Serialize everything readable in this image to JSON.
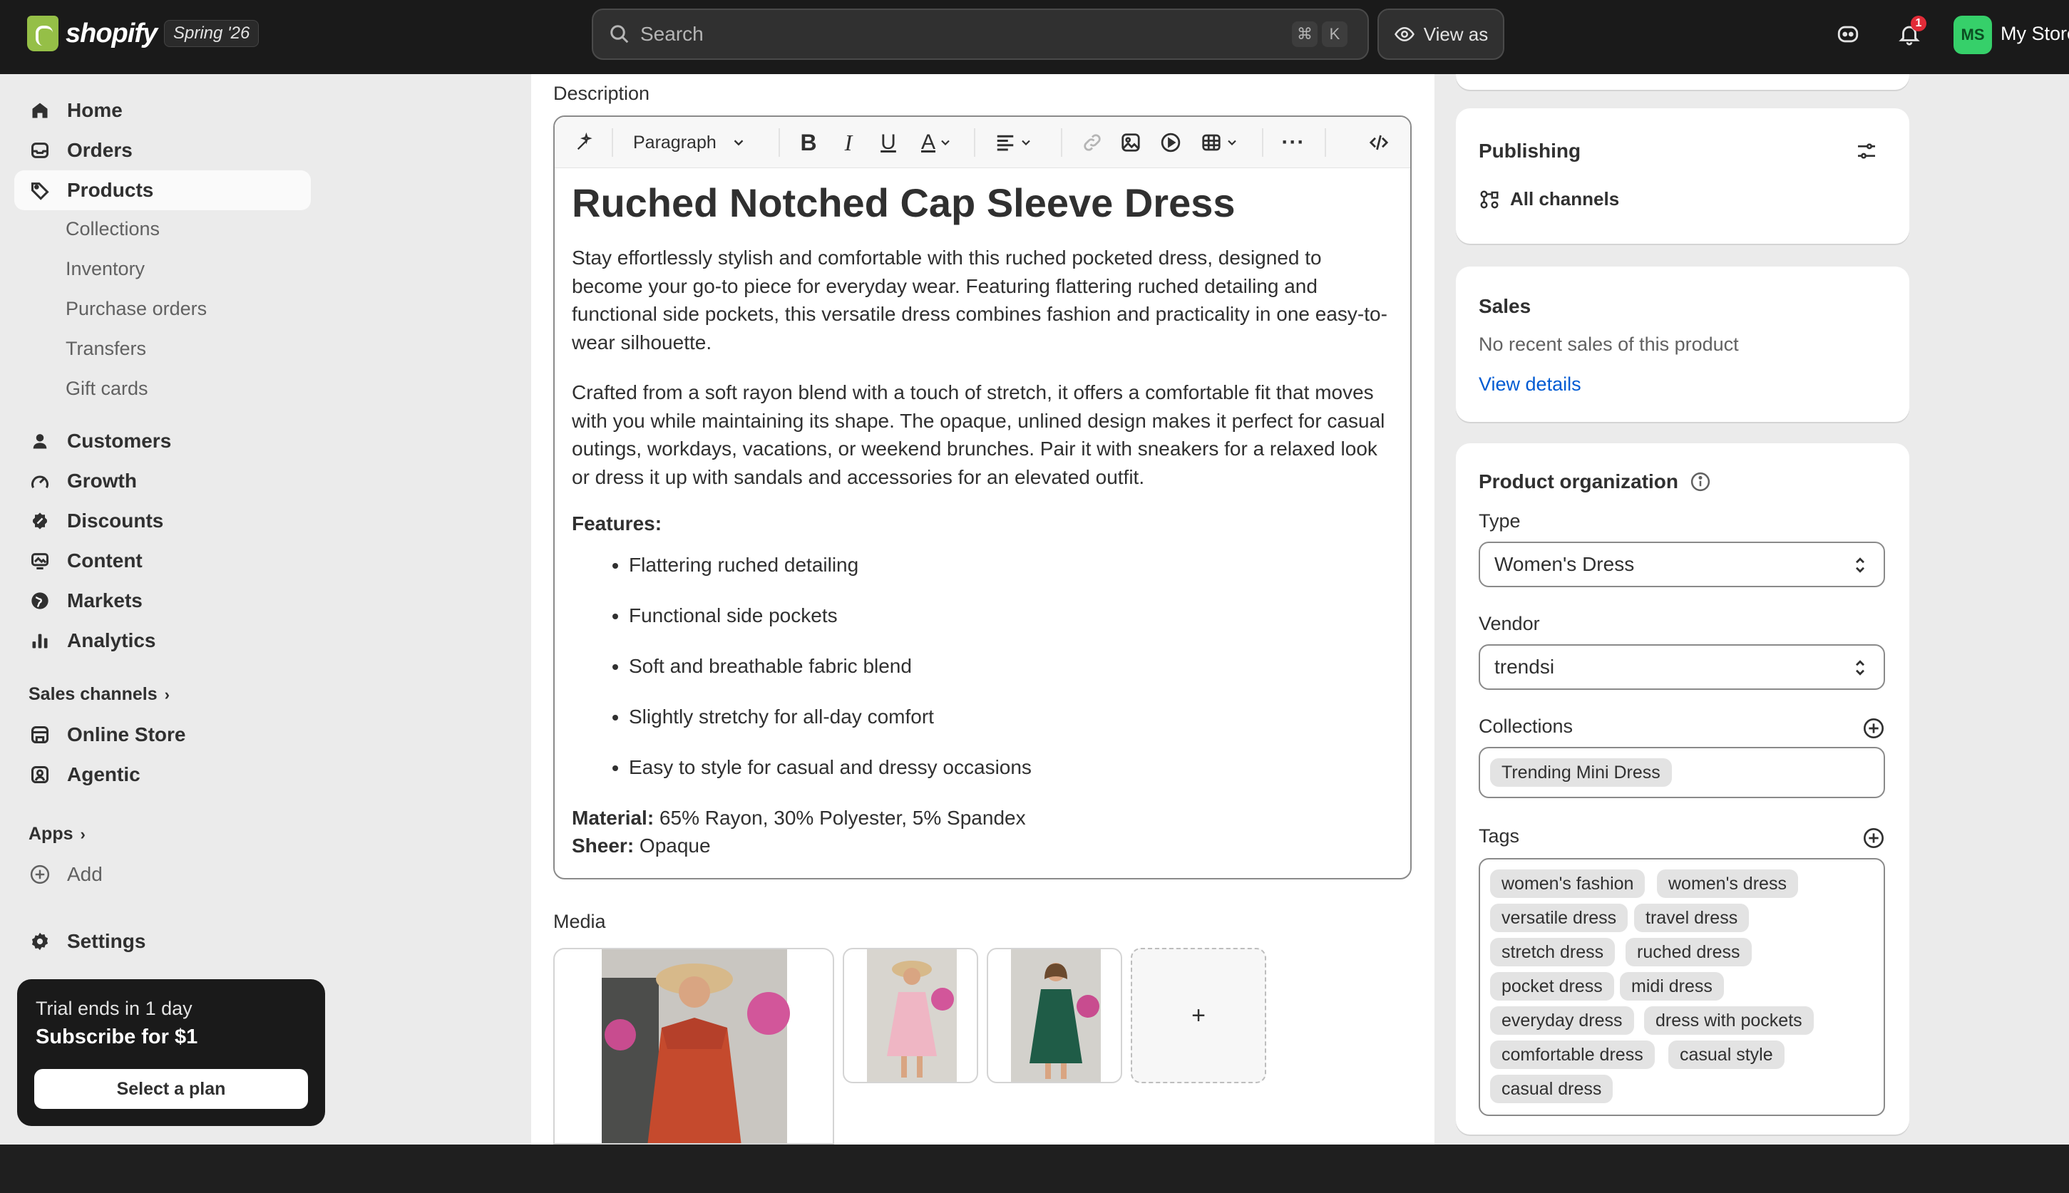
{
  "topbar": {
    "brand": "shopify",
    "edition": "Spring '26",
    "search_placeholder": "Search",
    "shortcut_cmd": "⌘",
    "shortcut_key": "K",
    "view_as": "View as",
    "notifications_count": "1",
    "avatar_initials": "MS",
    "store_name": "My Store"
  },
  "sidebar": {
    "items": [
      {
        "label": "Home",
        "icon": "home-icon"
      },
      {
        "label": "Orders",
        "icon": "inbox-icon"
      },
      {
        "label": "Products",
        "icon": "tag-icon"
      }
    ],
    "product_subitems": [
      "Collections",
      "Inventory",
      "Purchase orders",
      "Transfers",
      "Gift cards"
    ],
    "items2": [
      {
        "label": "Customers",
        "icon": "person-icon"
      },
      {
        "label": "Growth",
        "icon": "growth-icon"
      },
      {
        "label": "Discounts",
        "icon": "discount-icon"
      },
      {
        "label": "Content",
        "icon": "content-icon"
      },
      {
        "label": "Markets",
        "icon": "globe-icon"
      },
      {
        "label": "Analytics",
        "icon": "bar-chart-icon"
      }
    ],
    "sales_channels_label": "Sales channels",
    "channels": [
      {
        "label": "Online Store",
        "icon": "store-icon"
      },
      {
        "label": "Agentic",
        "icon": "agentic-icon"
      }
    ],
    "apps_label": "Apps",
    "add_label": "Add",
    "settings_label": "Settings",
    "trial": {
      "line1": "Trial ends in 1 day",
      "line2": "Subscribe for $1",
      "button": "Select a plan"
    }
  },
  "description": {
    "label": "Description",
    "toolbar": {
      "paragraph": "Paragraph"
    },
    "title": "Ruched Notched Cap Sleeve Dress",
    "p1": "Stay effortlessly stylish and comfortable with this ruched pocketed dress, designed to become your go-to piece for everyday wear. Featuring flattering ruched detailing and functional side pockets, this versatile dress combines fashion and practicality in one easy-to-wear silhouette.",
    "p2": "Crafted from a soft rayon blend with a touch of stretch, it offers a comfortable fit that moves with you while maintaining its shape. The opaque, unlined design makes it perfect for casual outings, workdays, vacations, or weekend brunches. Pair it with sneakers for a relaxed look or dress it up with sandals and accessories for an elevated outfit.",
    "features_heading": "Features:",
    "features": [
      "Flattering ruched detailing",
      "Functional side pockets",
      "Soft and breathable fabric blend",
      "Slightly stretchy for all-day comfort",
      "Easy to style for casual and dressy occasions"
    ],
    "material_label": "Material:",
    "material_value": " 65% Rayon, 30% Polyester, 5% Spandex",
    "sheer_label": "Sheer:",
    "sheer_value": " Opaque"
  },
  "media": {
    "label": "Media",
    "add_symbol": "+"
  },
  "publishing": {
    "title": "Publishing",
    "channels": "All channels"
  },
  "sales": {
    "title": "Sales",
    "text": "No recent sales of this product",
    "link": "View details"
  },
  "organization": {
    "title": "Product organization",
    "type_label": "Type",
    "type_value": "Women's Dress",
    "vendor_label": "Vendor",
    "vendor_value": "trendsi",
    "collections_label": "Collections",
    "collections": [
      "Trending Mini Dress"
    ],
    "tags_label": "Tags",
    "tags": [
      "women's fashion",
      "women's dress",
      "versatile dress",
      "travel dress",
      "stretch dress",
      "ruched dress",
      "pocket dress",
      "midi dress",
      "everyday dress",
      "dress with pockets",
      "comfortable dress",
      "casual style",
      "casual dress"
    ]
  },
  "colors": {
    "topbar": "#1a1a1a",
    "link": "#005bd3",
    "avatar": "#36d06a"
  }
}
